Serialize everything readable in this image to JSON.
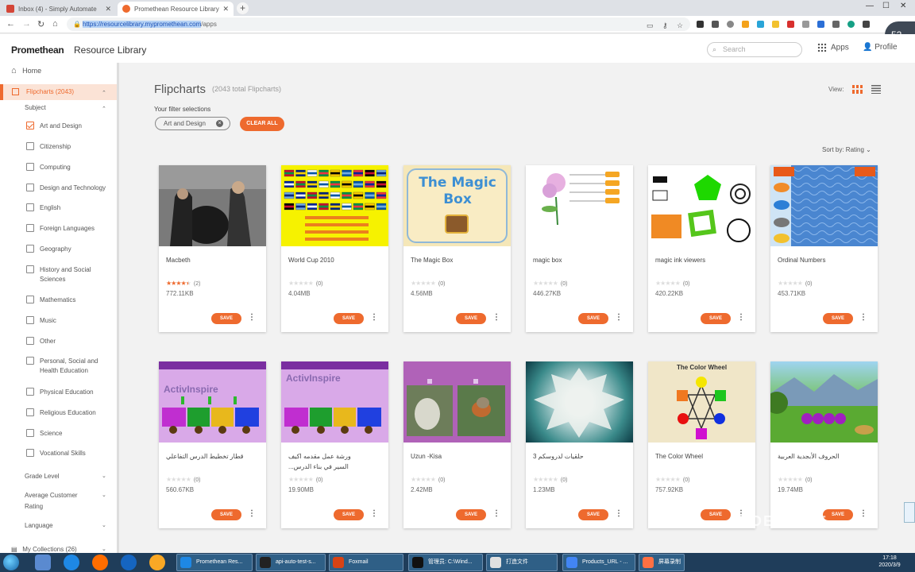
{
  "browser": {
    "tabs": [
      {
        "title": "Inbox (4) - Simply Automate",
        "favicon_color": "#d44638",
        "active": false
      },
      {
        "title": "Promethean Resource Library",
        "favicon_color": "#ee6a2e",
        "active": true
      }
    ],
    "url_selected": "https://resourcelibrary.mypromethean.com",
    "url_rest": "/apps",
    "zoom": "52",
    "zoom_unit": "x"
  },
  "header": {
    "logo": "Promethean",
    "subtitle": "Resource Library",
    "search_placeholder": "Search",
    "apps_label": "Apps",
    "profile_label": "Profile"
  },
  "sidebar": {
    "home": "Home",
    "flipcharts": "Flipcharts (2043)",
    "subject_label": "Subject",
    "subjects": [
      {
        "label": "Art and Design",
        "checked": true
      },
      {
        "label": "Citizenship",
        "checked": false
      },
      {
        "label": "Computing",
        "checked": false
      },
      {
        "label": "Design and Technology",
        "checked": false
      },
      {
        "label": "English",
        "checked": false
      },
      {
        "label": "Foreign Languages",
        "checked": false
      },
      {
        "label": "Geography",
        "checked": false
      },
      {
        "label": "History and Social",
        "label2": "Sciences",
        "checked": false
      },
      {
        "label": "Mathematics",
        "checked": false
      },
      {
        "label": "Music",
        "checked": false
      },
      {
        "label": "Other",
        "checked": false
      },
      {
        "label": "Personal, Social and",
        "label2": "Health Education",
        "checked": false
      },
      {
        "label": "Physical Education",
        "checked": false
      },
      {
        "label": "Religious Education",
        "checked": false
      },
      {
        "label": "Science",
        "checked": false
      },
      {
        "label": "Vocational Skills",
        "checked": false
      }
    ],
    "grade_level": "Grade Level",
    "avg_rating": "Average Customer",
    "avg_rating2": "Rating",
    "language": "Language",
    "my_collections": "My Collections (26)"
  },
  "main": {
    "title": "Flipcharts",
    "count": "(2043 total Flipcharts)",
    "view_label": "View:",
    "filter_label": "Your filter selections",
    "chip": "Art and Design",
    "clear_all": "CLEAR ALL",
    "sort": "Sort by: Rating"
  },
  "cards": [
    {
      "title": "Macbeth",
      "rating": 4.5,
      "count": "(2)",
      "size": "772.11KB",
      "save": "SAVE"
    },
    {
      "title": "World Cup 2010",
      "rating": 0,
      "count": "(0)",
      "size": "4.04MB",
      "save": "SAVE"
    },
    {
      "title": "The Magic Box",
      "rating": 0,
      "count": "(0)",
      "size": "4.56MB",
      "save": "SAVE"
    },
    {
      "title": "magic box",
      "rating": 0,
      "count": "(0)",
      "size": "446.27KB",
      "save": "SAVE"
    },
    {
      "title": "magic ink viewers",
      "rating": 0,
      "count": "(0)",
      "size": "420.22KB",
      "save": "SAVE"
    },
    {
      "title": "Ordinal Numbers",
      "rating": 0,
      "count": "(0)",
      "size": "453.71KB",
      "save": "SAVE"
    },
    {
      "title": "قطار تخطيط الدرس التفاعلي",
      "rating": 0,
      "count": "(0)",
      "size": "560.67KB",
      "save": "SAVE"
    },
    {
      "title": "ورشة عمل مقدمه اكيف",
      "title2": "...السير في بناء الدرس",
      "rating": 0,
      "count": "(0)",
      "size": "19.90MB",
      "save": "SAVE"
    },
    {
      "title": "Uzun -Kisa",
      "rating": 0,
      "count": "(0)",
      "size": "2.42MB",
      "save": "SAVE"
    },
    {
      "title": "3 حلقيات لدروسكم",
      "rating": 0,
      "count": "(0)",
      "size": "1.23MB",
      "save": "SAVE"
    },
    {
      "title": "The Color Wheel",
      "rating": 0,
      "count": "(0)",
      "size": "757.92KB",
      "save": "SAVE"
    },
    {
      "title": "الحروف الأبجدية العربية",
      "rating": 0,
      "count": "(0)",
      "size": "19.74MB",
      "save": "SAVE"
    }
  ],
  "thumb_text": {
    "magic_box": "The Magic Box",
    "activinspire": "ActivInspire",
    "color_wheel": "The Color Wheel"
  },
  "taskbar": {
    "items": [
      "Promethean Res...",
      "api-auto-test-s...",
      "Foxmail",
      "管理员: C:\\Wind...",
      "打造文件",
      "Products_URL - ...",
      "屏幕录制"
    ],
    "time": "17:18",
    "date": "2020/3/9"
  },
  "watermark": "BOE 京东方"
}
